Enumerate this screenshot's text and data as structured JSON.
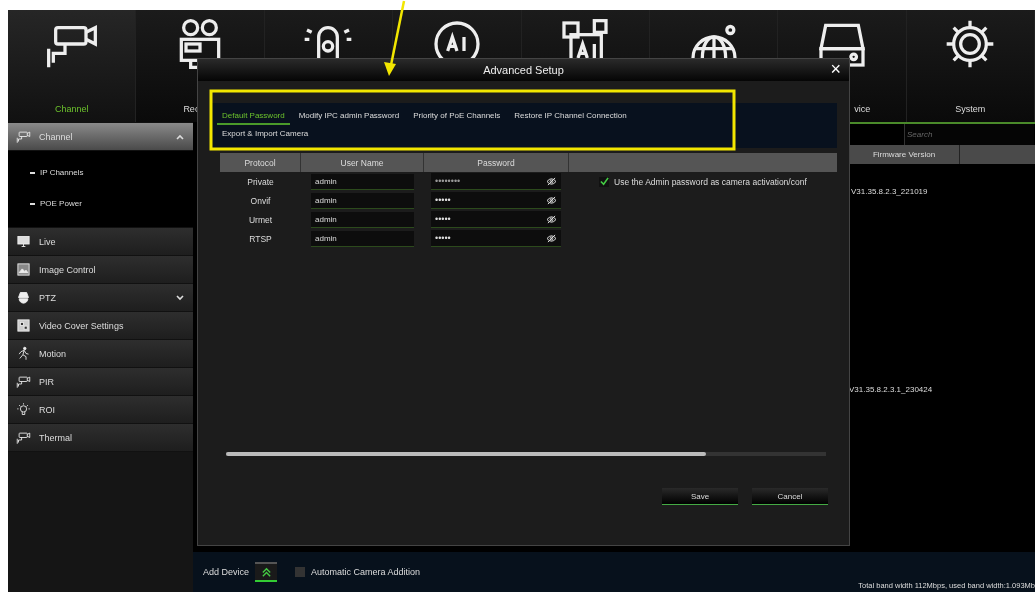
{
  "top_nav": [
    {
      "kind": "camera",
      "label": "Channel",
      "selected": true
    },
    {
      "kind": "recorder",
      "label": "Rec",
      "selected": false
    },
    {
      "kind": "alarm"
    },
    {
      "kind": "ai"
    },
    {
      "kind": "ai-box"
    },
    {
      "kind": "network"
    },
    {
      "kind": "storage",
      "label": "vice",
      "selected": false
    },
    {
      "kind": "settings",
      "label": "System",
      "selected": false
    }
  ],
  "sidebar": {
    "items": [
      {
        "kind": "camera",
        "label": "Channel",
        "selected": true,
        "expanded": true,
        "children": [
          {
            "label": "IP Channels"
          },
          {
            "label": "POE Power"
          }
        ]
      },
      {
        "kind": "monitor",
        "label": "Live",
        "selected": false
      },
      {
        "kind": "image",
        "label": "Image Control",
        "selected": false
      },
      {
        "kind": "dome",
        "label": "PTZ",
        "selected": false,
        "expanded": false
      },
      {
        "kind": "cover",
        "label": "Video Cover Settings",
        "selected": false
      },
      {
        "kind": "motion",
        "label": "Motion",
        "selected": false
      },
      {
        "kind": "camera",
        "label": "PIR",
        "selected": false
      },
      {
        "kind": "bulb",
        "label": "ROI",
        "selected": false
      },
      {
        "kind": "camera",
        "label": "Thermal",
        "selected": false
      }
    ]
  },
  "search": {
    "placeholder": "Search"
  },
  "device_table": {
    "columns": [
      "Firmware Version"
    ],
    "rows": [
      "V31.35.8.2.3_221019",
      "V31.35.8.2.3.1_230424"
    ]
  },
  "dialog": {
    "title": "Advanced Setup",
    "close": "×",
    "tabs": [
      {
        "label": "Default Password",
        "selected": true
      },
      {
        "label": "Modify IPC admin Password",
        "selected": false
      },
      {
        "label": "Priority of PoE Channels",
        "selected": false
      },
      {
        "label": "Restore IP Channel Connection",
        "selected": false
      },
      {
        "label": "Export & Import Camera",
        "selected": false
      }
    ],
    "table": {
      "columns": [
        "Protocol",
        "User Name",
        "Password"
      ],
      "rows": [
        {
          "protocol": "Private",
          "user": "admin",
          "password": "••••••••"
        },
        {
          "protocol": "Onvif",
          "user": "admin",
          "password": "•••••"
        },
        {
          "protocol": "Urmet",
          "user": "admin",
          "password": "•••••"
        },
        {
          "protocol": "RTSP",
          "user": "admin",
          "password": "•••••"
        }
      ]
    },
    "option": {
      "label": "Use the Admin password as camera activation/conf",
      "checked": true
    },
    "buttons": [
      "Save",
      "Cancel"
    ]
  },
  "bottom_bar": {
    "add_device": "Add Device",
    "auto_add": {
      "label": "Automatic Camera Addition",
      "checked": false
    },
    "bandwidth": "Total band width 112Mbps, used band width:1.093Mb"
  }
}
